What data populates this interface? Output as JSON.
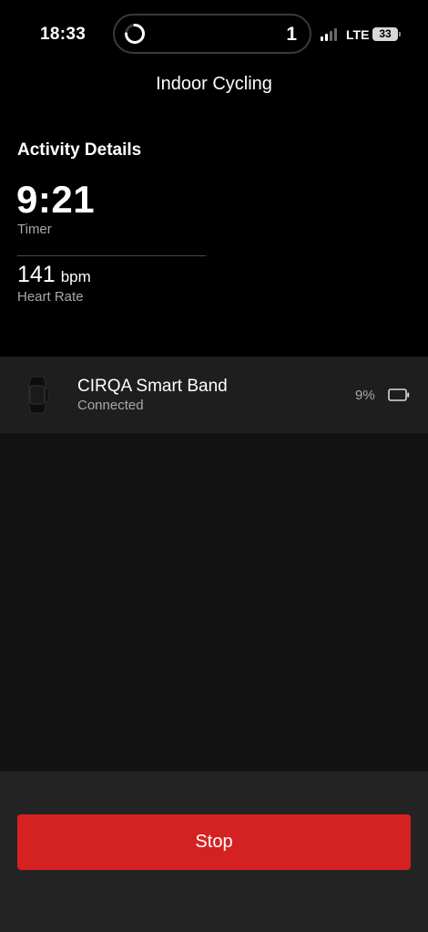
{
  "status_bar": {
    "time": "18:33",
    "island_count": "1",
    "network": "LTE",
    "battery_level": "33",
    "signal_bars_active": 2,
    "signal_bars_total": 4,
    "activity_ring_icon": "activity-ring-icon"
  },
  "header": {
    "title": "Indoor Cycling"
  },
  "activity": {
    "heading": "Activity Details",
    "timer_value": "9:21",
    "timer_label": "Timer",
    "heart_rate_value": "141",
    "heart_rate_unit": "bpm",
    "heart_rate_label": "Heart Rate"
  },
  "device": {
    "name": "CIRQA Smart Band",
    "status": "Connected",
    "battery_text": "9%",
    "icon": "smart-band-icon",
    "battery_icon": "battery-outline-icon"
  },
  "footer": {
    "stop_label": "Stop"
  },
  "colors": {
    "background": "#000000",
    "panel": "#1e1e1e",
    "content": "#121212",
    "footer": "#232323",
    "stop_button": "#d42222",
    "secondary_text": "#a8a8a8"
  }
}
